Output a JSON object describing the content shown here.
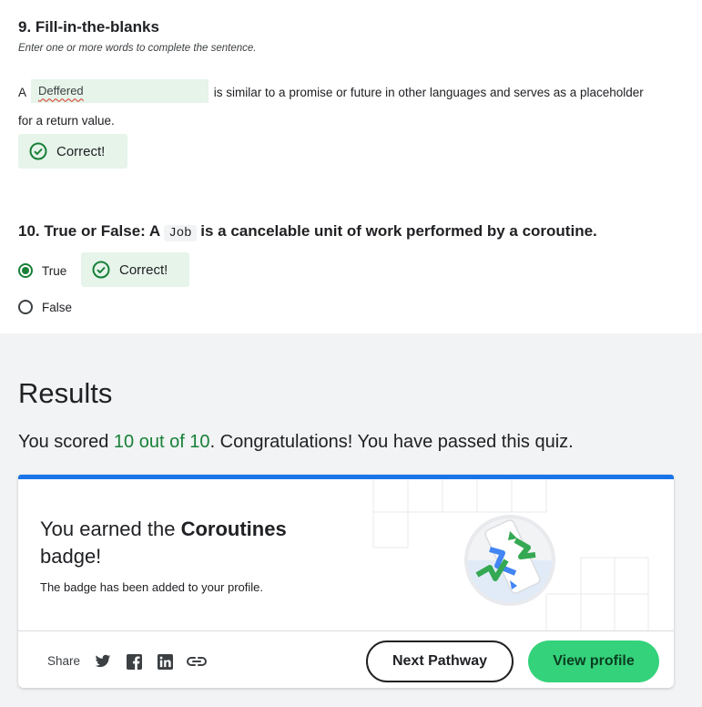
{
  "q9": {
    "title": "9. Fill-in-the-blanks",
    "instruction": "Enter one or more words to complete the sentence.",
    "prefix": "A",
    "answer": "Deffered",
    "suffix": "is similar to a promise or future in other languages and serves as a placeholder for a return value.",
    "feedback": "Correct!"
  },
  "q10": {
    "title_prefix": "10. True or False: A",
    "code": "Job",
    "title_suffix": "is a cancelable unit of work performed by a coroutine.",
    "options": [
      {
        "label": "True",
        "selected": true
      },
      {
        "label": "False",
        "selected": false
      }
    ],
    "feedback": "Correct!"
  },
  "results": {
    "title": "Results",
    "text_prefix": "You scored",
    "score": "10 out of 10",
    "text_suffix": ". Congratulations! You have passed this quiz."
  },
  "badge": {
    "heading_prefix": "You earned the",
    "badge_name": "Coroutines",
    "heading_suffix": "badge!",
    "subtext": "The badge has been added to your profile.",
    "share_label": "Share",
    "share_icons": [
      "twitter-icon",
      "facebook-icon",
      "linkedin-icon",
      "link-icon"
    ],
    "next_label": "Next Pathway",
    "profile_label": "View profile"
  },
  "colors": {
    "correct_green": "#188038",
    "correct_bg": "#e6f4ea",
    "accent_blue": "#1a73e8",
    "button_green": "#34d27b"
  }
}
